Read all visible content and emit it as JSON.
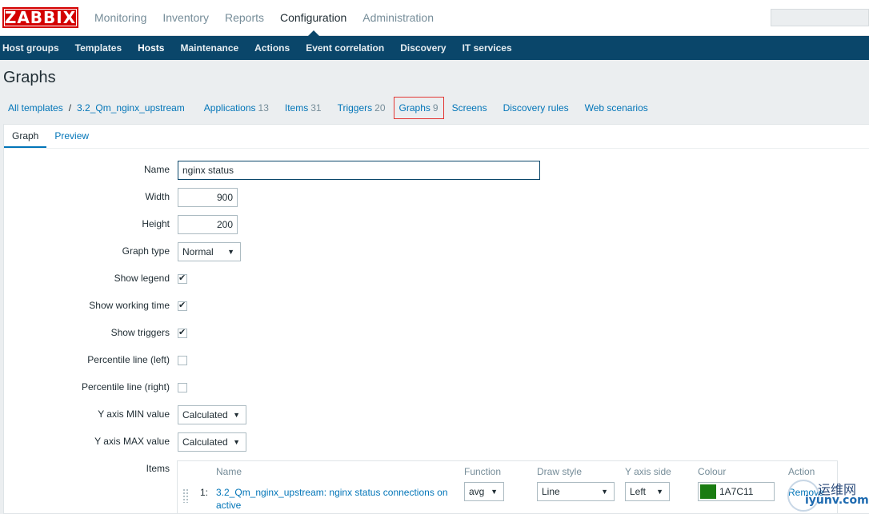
{
  "app": {
    "logo": "ZABBIX"
  },
  "main_menu": [
    {
      "label": "Monitoring",
      "selected": false
    },
    {
      "label": "Inventory",
      "selected": false
    },
    {
      "label": "Reports",
      "selected": false
    },
    {
      "label": "Configuration",
      "selected": true
    },
    {
      "label": "Administration",
      "selected": false
    }
  ],
  "sub_menu": [
    {
      "label": "Host groups"
    },
    {
      "label": "Templates"
    },
    {
      "label": "Hosts"
    },
    {
      "label": "Maintenance"
    },
    {
      "label": "Actions"
    },
    {
      "label": "Event correlation"
    },
    {
      "label": "Discovery"
    },
    {
      "label": "IT services"
    }
  ],
  "page": {
    "title": "Graphs"
  },
  "breadcrumb": {
    "all_templates": "All templates",
    "separator": "/",
    "template": "3.2_Qm_nginx_upstream",
    "links": [
      {
        "label": "Applications",
        "count": "13"
      },
      {
        "label": "Items",
        "count": "31"
      },
      {
        "label": "Triggers",
        "count": "20"
      },
      {
        "label": "Graphs",
        "count": "9"
      },
      {
        "label": "Screens",
        "count": ""
      },
      {
        "label": "Discovery rules",
        "count": ""
      },
      {
        "label": "Web scenarios",
        "count": ""
      }
    ]
  },
  "tabs": {
    "graph": "Graph",
    "preview": "Preview"
  },
  "form": {
    "name_label": "Name",
    "name_value": "nginx status",
    "width_label": "Width",
    "width_value": "900",
    "height_label": "Height",
    "height_value": "200",
    "graph_type_label": "Graph type",
    "graph_type_value": "Normal",
    "show_legend_label": "Show legend",
    "show_working_time_label": "Show working time",
    "show_triggers_label": "Show triggers",
    "percentile_left_label": "Percentile line (left)",
    "percentile_right_label": "Percentile line (right)",
    "ymin_label": "Y axis MIN value",
    "ymin_value": "Calculated",
    "ymax_label": "Y axis MAX value",
    "ymax_value": "Calculated",
    "items_label": "Items"
  },
  "items_table": {
    "headers": {
      "name": "Name",
      "function": "Function",
      "draw_style": "Draw style",
      "y_axis_side": "Y axis side",
      "colour": "Colour",
      "action": "Action"
    },
    "rows": [
      {
        "no": "1:",
        "name": "3.2_Qm_nginx_upstream: nginx status connections on active",
        "function": "avg",
        "draw_style": "Line",
        "y_axis_side": "Left",
        "colour": "1A7C11",
        "action": "Remove"
      }
    ]
  },
  "watermark": {
    "line1": "运维网",
    "line2": "iyunv.com"
  }
}
